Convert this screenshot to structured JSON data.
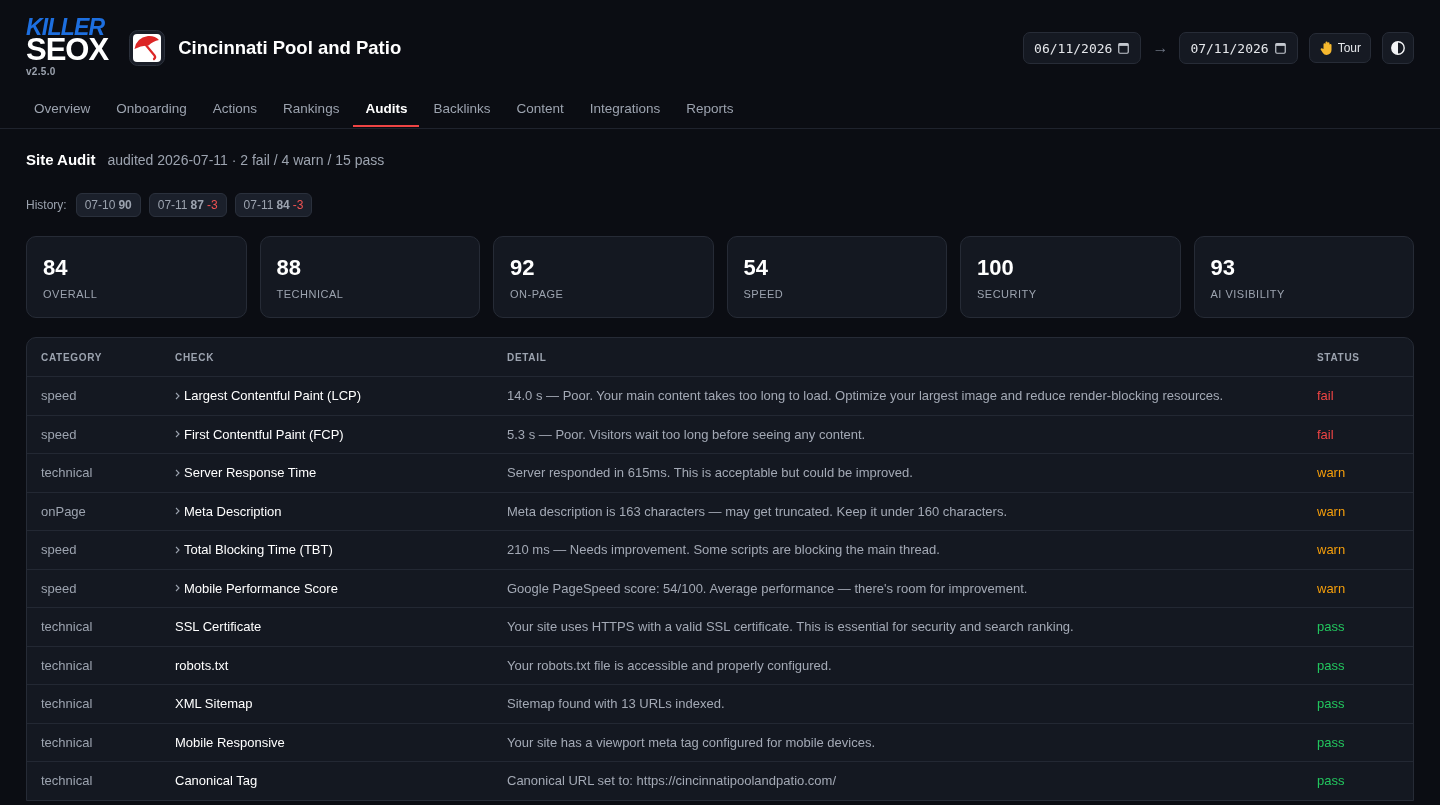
{
  "logo": {
    "line1": "KILLER",
    "line2": "SEOX",
    "version": "v2.5.0"
  },
  "site": {
    "name": "Cincinnati Pool and Patio"
  },
  "date_range": {
    "start": "06/11/2026",
    "separator": "→",
    "end": "07/11/2026"
  },
  "tour_button": {
    "label": "Tour"
  },
  "tabs": [
    {
      "label": "Overview",
      "selected": false
    },
    {
      "label": "Onboarding",
      "selected": false
    },
    {
      "label": "Actions",
      "selected": false
    },
    {
      "label": "Rankings",
      "selected": false
    },
    {
      "label": "Audits",
      "selected": true
    },
    {
      "label": "Backlinks",
      "selected": false
    },
    {
      "label": "Content",
      "selected": false
    },
    {
      "label": "Integrations",
      "selected": false
    },
    {
      "label": "Reports",
      "selected": false
    }
  ],
  "audit": {
    "title": "Site Audit",
    "summary": "audited 2026-07-11 · 2 fail / 4 warn / 15 pass"
  },
  "history": {
    "label": "History:",
    "entries": [
      {
        "date": "07-10",
        "score": "90"
      },
      {
        "date": "07-11",
        "score": "87",
        "delta": "-3"
      },
      {
        "date": "07-11",
        "score": "84",
        "delta": "-3"
      }
    ]
  },
  "scores": [
    {
      "value": "84",
      "label": "OVERALL"
    },
    {
      "value": "88",
      "label": "TECHNICAL"
    },
    {
      "value": "92",
      "label": "ON-PAGE"
    },
    {
      "value": "54",
      "label": "SPEED"
    },
    {
      "value": "100",
      "label": "SECURITY"
    },
    {
      "value": "93",
      "label": "AI VISIBILITY"
    }
  ],
  "table": {
    "columns": [
      "CATEGORY",
      "CHECK",
      "DETAIL",
      "STATUS"
    ],
    "rows": [
      {
        "category": "speed",
        "check": "Largest Contentful Paint (LCP)",
        "expandable": true,
        "detail": "14.0 s — Poor. Your main content takes too long to load. Optimize your largest image and reduce render-blocking resources.",
        "status": {
          "text": "fail",
          "color": "#ef4444"
        }
      },
      {
        "category": "speed",
        "check": "First Contentful Paint (FCP)",
        "expandable": true,
        "detail": "5.3 s — Poor. Visitors wait too long before seeing any content.",
        "status": {
          "text": "fail",
          "color": "#ef4444"
        }
      },
      {
        "category": "technical",
        "check": "Server Response Time",
        "expandable": true,
        "detail": "Server responded in 615ms. This is acceptable but could be improved.",
        "status": {
          "text": "warn",
          "color": "#f59e0b"
        }
      },
      {
        "category": "onPage",
        "check": "Meta Description",
        "expandable": true,
        "detail": "Meta description is 163 characters — may get truncated. Keep it under 160 characters.",
        "status": {
          "text": "warn",
          "color": "#f59e0b"
        }
      },
      {
        "category": "speed",
        "check": "Total Blocking Time (TBT)",
        "expandable": true,
        "detail": "210 ms — Needs improvement. Some scripts are blocking the main thread.",
        "status": {
          "text": "warn",
          "color": "#f59e0b"
        }
      },
      {
        "category": "speed",
        "check": "Mobile Performance Score",
        "expandable": true,
        "detail": "Google PageSpeed score: 54/100. Average performance — there's room for improvement.",
        "status": {
          "text": "warn",
          "color": "#f59e0b"
        }
      },
      {
        "category": "technical",
        "check": "SSL Certificate",
        "expandable": false,
        "detail": "Your site uses HTTPS with a valid SSL certificate. This is essential for security and search ranking.",
        "status": {
          "text": "pass",
          "color": "#22c55e"
        }
      },
      {
        "category": "technical",
        "check": "robots.txt",
        "expandable": false,
        "detail": "Your robots.txt file is accessible and properly configured.",
        "status": {
          "text": "pass",
          "color": "#22c55e"
        }
      },
      {
        "category": "technical",
        "check": "XML Sitemap",
        "expandable": false,
        "detail": "Sitemap found with 13 URLs indexed.",
        "status": {
          "text": "pass",
          "color": "#22c55e"
        }
      },
      {
        "category": "technical",
        "check": "Mobile Responsive",
        "expandable": false,
        "detail": "Your site has a viewport meta tag configured for mobile devices.",
        "status": {
          "text": "pass",
          "color": "#22c55e"
        }
      },
      {
        "category": "technical",
        "check": "Canonical Tag",
        "expandable": false,
        "detail": "Canonical URL set to: https://cincinnatipoolandpatio.com/",
        "status": {
          "text": "pass",
          "color": "#22c55e"
        }
      }
    ]
  }
}
